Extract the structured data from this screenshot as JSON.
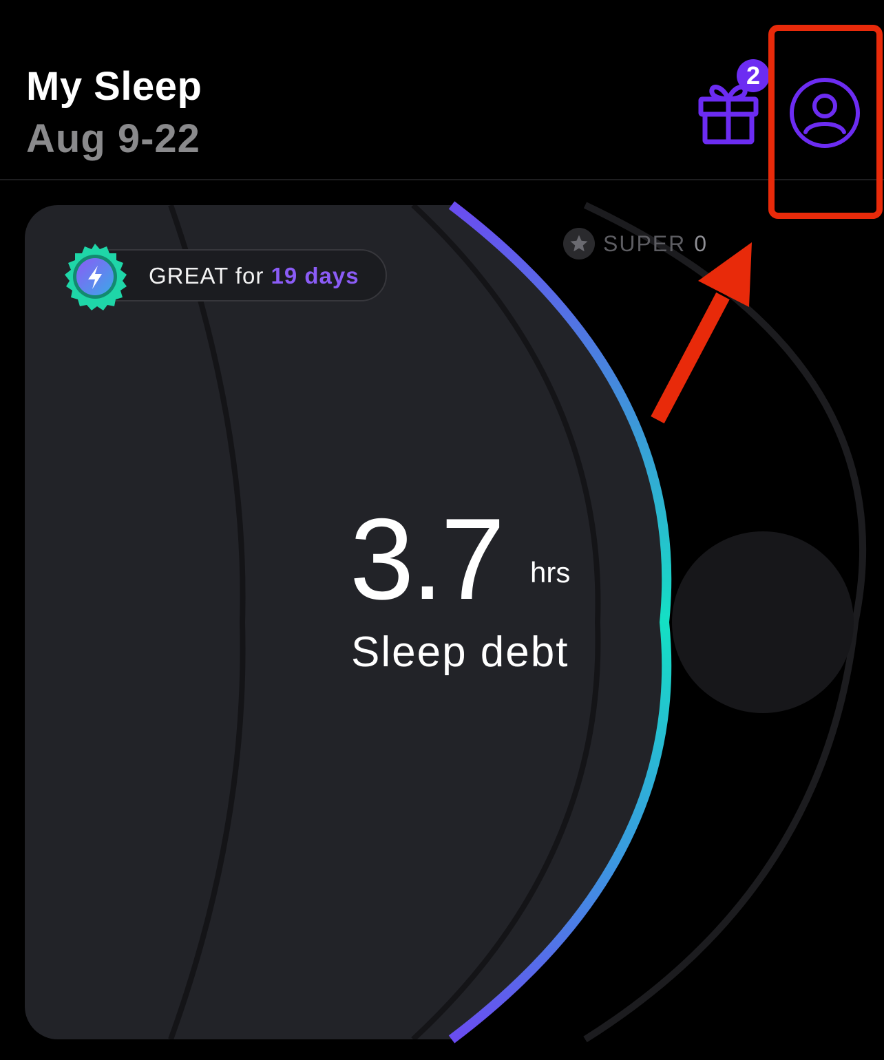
{
  "header": {
    "title": "My Sleep",
    "date_range": "Aug 9-22"
  },
  "gift": {
    "icon": "gift-icon",
    "badge_count": "2"
  },
  "profile": {
    "icon": "user-circle-icon"
  },
  "super": {
    "label": "SUPER",
    "count": "0"
  },
  "streak": {
    "prefix": "GREAT for",
    "days": "19 days"
  },
  "sleep_debt": {
    "value": "3.7",
    "unit": "hrs",
    "label": "Sleep debt"
  },
  "colors": {
    "accent": "#6c2cf2",
    "highlight": "#e82a0a",
    "ring_top": "#6a4cf0",
    "ring_mid": "#14e0c4",
    "card": "#222328"
  }
}
